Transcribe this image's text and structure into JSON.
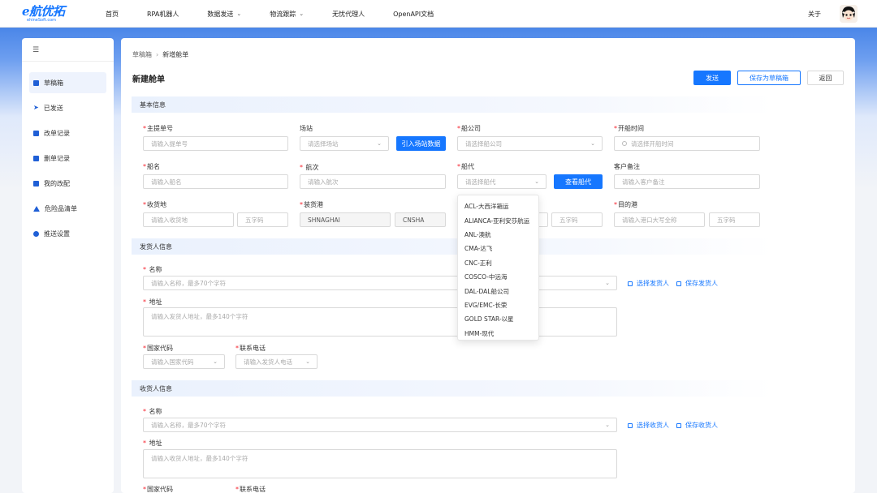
{
  "brand": {
    "logo_text": "e航优拓",
    "logo_sub": "ehineSoft.com"
  },
  "nav": {
    "items": [
      {
        "label": "首页",
        "dropdown": false
      },
      {
        "label": "RPA机器人",
        "dropdown": false
      },
      {
        "label": "数据发送",
        "dropdown": true
      },
      {
        "label": "物流跟踪",
        "dropdown": true
      },
      {
        "label": "无忧代理人",
        "dropdown": false
      },
      {
        "label": "OpenAPI文档",
        "dropdown": false
      }
    ],
    "about": "关于"
  },
  "sidebar": {
    "items": [
      {
        "label": "草稿箱",
        "icon": "draft-icon",
        "active": true
      },
      {
        "label": "已发送",
        "icon": "send-icon",
        "active": false
      },
      {
        "label": "改单记录",
        "icon": "edit-record-icon",
        "active": false
      },
      {
        "label": "删单记录",
        "icon": "delete-record-icon",
        "active": false
      },
      {
        "label": "我的改配",
        "icon": "reassign-icon",
        "active": false
      },
      {
        "label": "危险品清单",
        "icon": "warning-icon",
        "active": false
      },
      {
        "label": "推送设置",
        "icon": "settings-icon",
        "active": false
      }
    ]
  },
  "breadcrumb": {
    "root": "草稿箱",
    "current": "新增舱单"
  },
  "page": {
    "title": "新建舱单",
    "send_label": "发送",
    "save_draft_label": "保存为草稿箱",
    "back_label": "返回"
  },
  "basic": {
    "section_title": "基本信息",
    "master_bl": {
      "label": "主提单号",
      "placeholder": "请输入提单号"
    },
    "yard": {
      "label": "场站",
      "placeholder": "请选择场站",
      "import_button": "引入场站数据"
    },
    "carrier": {
      "label": "船公司",
      "placeholder": "请选择船公司"
    },
    "sailing_time": {
      "label": "开船时间",
      "placeholder": "请选择开船时间"
    },
    "vessel": {
      "label": "船名",
      "placeholder": "请输入船名"
    },
    "voyage": {
      "label": "航次",
      "placeholder": "请输入航次"
    },
    "ship_agent": {
      "label": "船代",
      "placeholder": "请选择船代",
      "view_button": "查看船代"
    },
    "customer_note": {
      "label": "客户备注",
      "placeholder": "请输入客户备注"
    },
    "receipt_place": {
      "label": "收货地",
      "placeholder": "请输入收货地",
      "code_placeholder": "五字码"
    },
    "loading_port": {
      "label": "装货港",
      "value": "SHNAGHAI",
      "code_value": "CNSHA"
    },
    "discharge_code_placeholder": "五字码",
    "destination": {
      "label": "目的港",
      "placeholder": "请输入港口大写全称",
      "code_placeholder": "五字码"
    }
  },
  "ship_agent_options": [
    "ACL-大西洋箱运",
    "ALIANCA-亚利安莎航运",
    "ANL-澳航",
    "CMA-达飞",
    "CNC-正利",
    "COSCO-中远海",
    "DAL-DAL船公司",
    "EVG/EMC-长荣",
    "GOLD STAR-以星",
    "HMM-现代"
  ],
  "shipper": {
    "section_title": "发货人信息",
    "name_label": "名称",
    "name_placeholder": "请输入名称，最多70个字符",
    "select_link": "选择发货人",
    "save_link": "保存发货人",
    "address_label": "地址",
    "address_placeholder": "请输入发货人地址，最多140个字符",
    "country_label": "国家代码",
    "country_placeholder": "请输入国家代码",
    "phone_label": "联系电话",
    "phone_placeholder": "请输入发货人电话"
  },
  "consignee": {
    "section_title": "收货人信息",
    "name_label": "名称",
    "name_placeholder": "请输入名称，最多70个字符",
    "select_link": "选择收货人",
    "save_link": "保存收货人",
    "address_label": "地址",
    "address_placeholder": "请输入收货人地址，最多140个字符",
    "country_label": "国家代码",
    "phone_label": "联系电话"
  },
  "colors": {
    "primary": "#1677ff",
    "required": "#f5222d",
    "sidebar_active_bg": "#eef3fd"
  }
}
